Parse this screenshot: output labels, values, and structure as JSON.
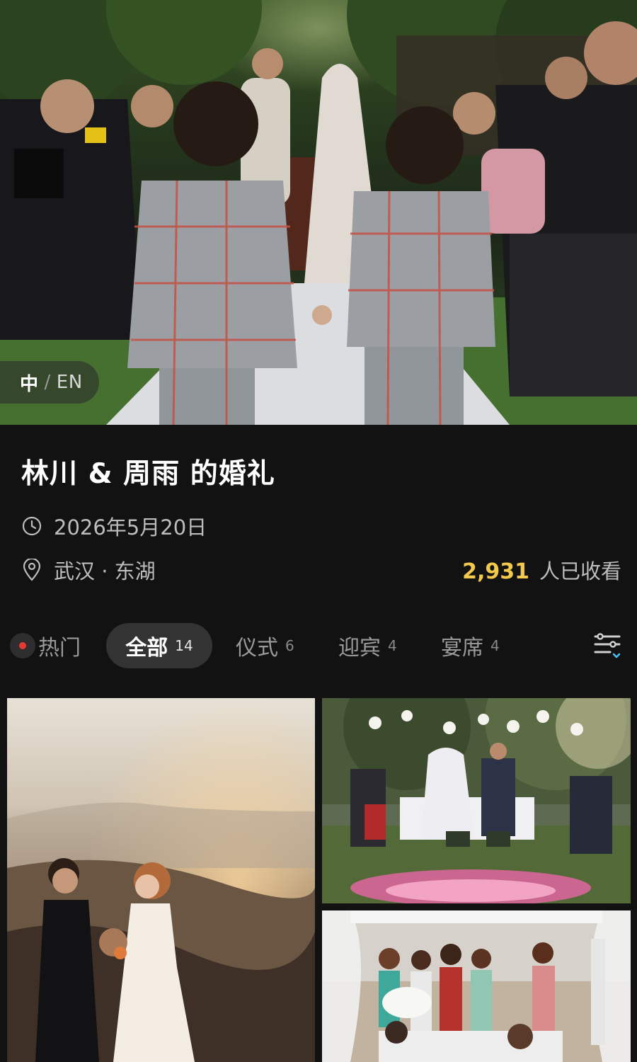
{
  "hero": {
    "image": "wedding-aisle-photo",
    "language_toggle": {
      "active": "中",
      "separator": "/",
      "inactive": "EN"
    }
  },
  "event": {
    "title": "林川 & 周雨 的婚礼",
    "date": "2026年5月20日",
    "location": "武汉 · 东湖",
    "views_count": "2,931",
    "views_label": "人已收看"
  },
  "tabs": [
    {
      "label": "热门",
      "count": "",
      "active": false,
      "icon": "red-dot"
    },
    {
      "label": "全部",
      "count": "14",
      "active": true
    },
    {
      "label": "仪式",
      "count": "6",
      "active": false
    },
    {
      "label": "迎宾",
      "count": "4",
      "active": false
    },
    {
      "label": "宴席",
      "count": "4",
      "active": false
    }
  ],
  "icons": {
    "date": "clock-icon",
    "location": "location-pin-icon",
    "filter": "filter-sort-icon"
  },
  "colors": {
    "background": "#121212",
    "accent_views": "#f2c94c",
    "hot_dot": "#e53935",
    "active_tab_bg": "#333333",
    "filter_chevron": "#4fc3f7"
  },
  "gallery": [
    {
      "image": "couple-mountain-sunset-photo"
    },
    {
      "image": "garden-ceremony-photo"
    },
    {
      "image": "beach-bridesmaids-photo"
    }
  ]
}
